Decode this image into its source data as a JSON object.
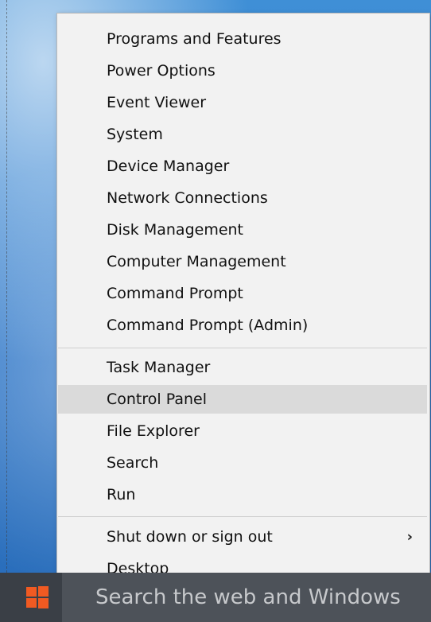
{
  "menu": {
    "group1": [
      {
        "label": "Programs and Features"
      },
      {
        "label": "Power Options"
      },
      {
        "label": "Event Viewer"
      },
      {
        "label": "System"
      },
      {
        "label": "Device Manager"
      },
      {
        "label": "Network Connections"
      },
      {
        "label": "Disk Management"
      },
      {
        "label": "Computer Management"
      },
      {
        "label": "Command Prompt"
      },
      {
        "label": "Command Prompt (Admin)"
      }
    ],
    "group2": [
      {
        "label": "Task Manager"
      },
      {
        "label": "Control Panel"
      },
      {
        "label": "File Explorer"
      },
      {
        "label": "Search"
      },
      {
        "label": "Run"
      }
    ],
    "group3": [
      {
        "label": "Shut down or sign out",
        "submenu_arrow": "›"
      },
      {
        "label": "Desktop"
      }
    ]
  },
  "taskbar": {
    "start_icon": "windows-logo-icon",
    "search_placeholder": "Search the web and Windows"
  },
  "colors": {
    "menu_background": "#f2f2f2",
    "selected_item": "#dadada",
    "taskbar": "#3a3f46",
    "search_box": "#4d5259",
    "start_logo": "#f05a22"
  }
}
